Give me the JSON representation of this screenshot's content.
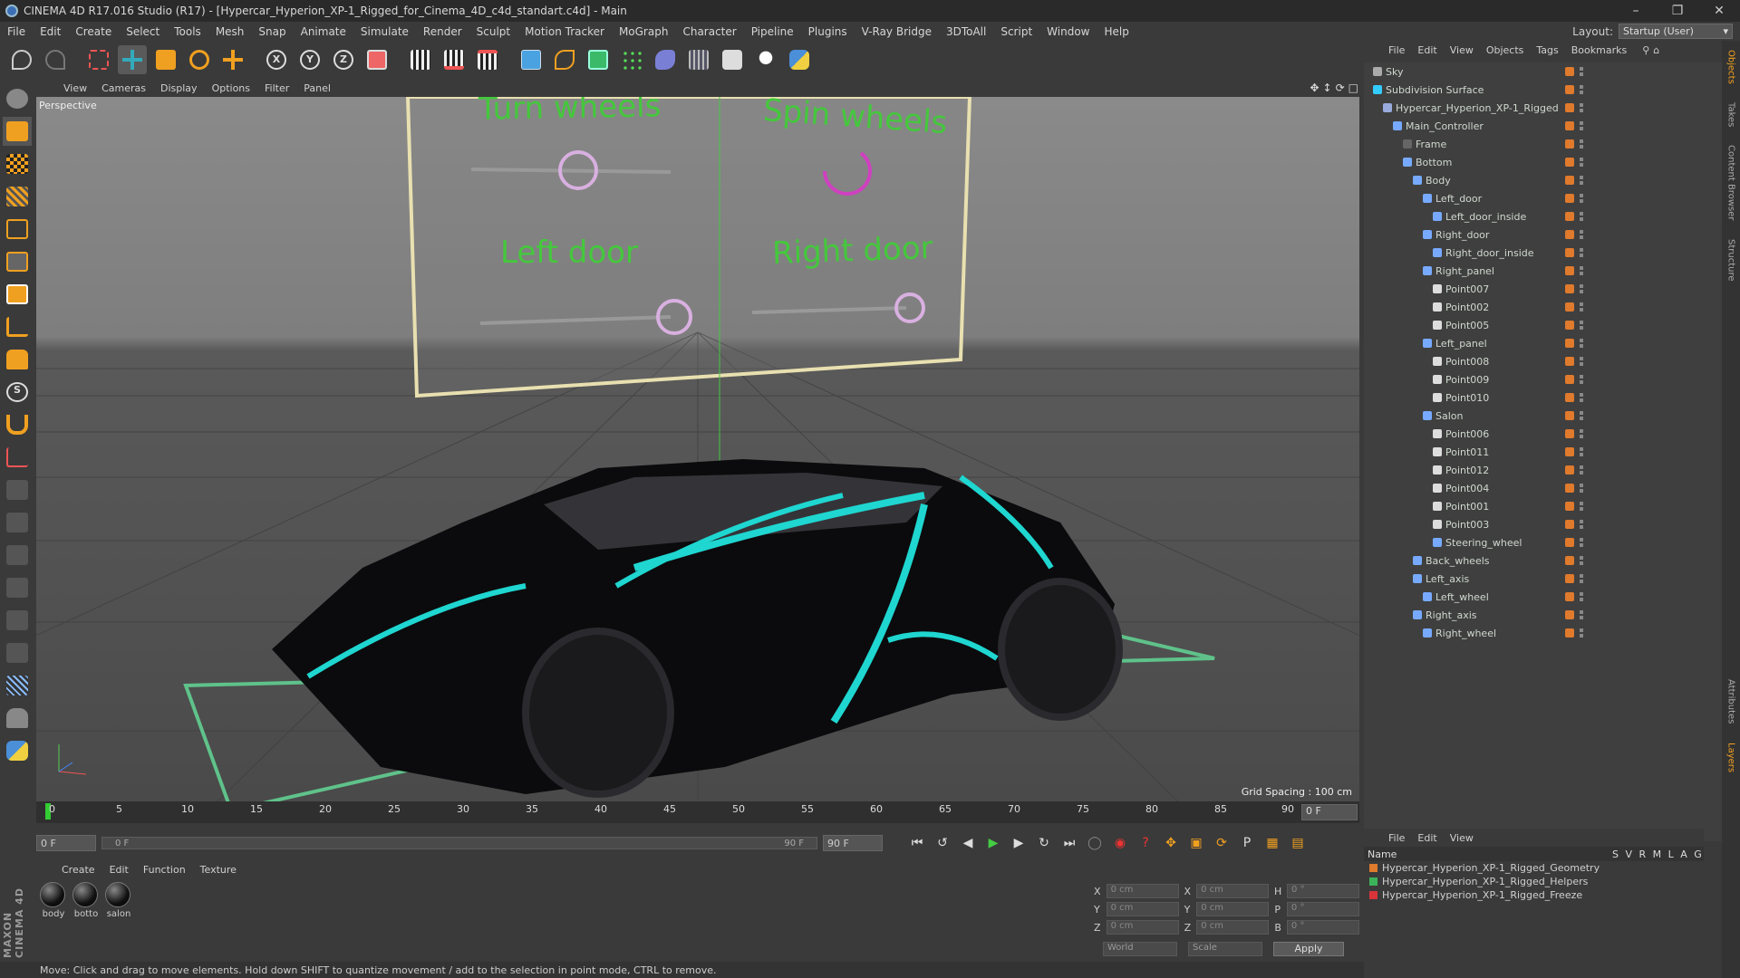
{
  "window": {
    "title": "CINEMA 4D R17.016 Studio (R17) - [Hypercar_Hyperion_XP-1_Rigged_for_Cinema_4D_c4d_standart.c4d] - Main"
  },
  "menubar": [
    "File",
    "Edit",
    "Create",
    "Select",
    "Tools",
    "Mesh",
    "Snap",
    "Animate",
    "Simulate",
    "Render",
    "Sculpt",
    "Motion Tracker",
    "MoGraph",
    "Character",
    "Pipeline",
    "Plugins",
    "V-Ray Bridge",
    "3DToAll",
    "Script",
    "Window",
    "Help"
  ],
  "layout": {
    "label": "Layout:",
    "value": "Startup (User)"
  },
  "viewport": {
    "menu": [
      "View",
      "Cameras",
      "Display",
      "Options",
      "Filter",
      "Panel"
    ],
    "label": "Perspective",
    "grid_spacing": "Grid Spacing : 100 cm",
    "controls": {
      "turn_wheels": "Turn wheels",
      "spin_wheels": "Spin wheels",
      "left_door": "Left door",
      "right_door": "Right door"
    }
  },
  "timeline": {
    "ticks": [
      "0",
      "5",
      "10",
      "15",
      "20",
      "25",
      "30",
      "35",
      "40",
      "45",
      "50",
      "55",
      "60",
      "65",
      "70",
      "75",
      "80",
      "85",
      "90"
    ],
    "current": "0 F"
  },
  "range": {
    "start": "0 F",
    "slider_start": "0 F",
    "slider_end": "90 F",
    "end": "90 F"
  },
  "materials": {
    "menu": [
      "Create",
      "Edit",
      "Function",
      "Texture"
    ],
    "items": [
      "body",
      "botto",
      "salon"
    ]
  },
  "coords": {
    "rows": [
      {
        "a1": "X",
        "v1": "0 cm",
        "a2": "X",
        "v2": "0 cm",
        "a3": "H",
        "v3": "0 °"
      },
      {
        "a1": "Y",
        "v1": "0 cm",
        "a2": "Y",
        "v2": "0 cm",
        "a3": "P",
        "v3": "0 °"
      },
      {
        "a1": "Z",
        "v1": "0 cm",
        "a2": "Z",
        "v2": "0 cm",
        "a3": "B",
        "v3": "0 °"
      }
    ],
    "world": "World",
    "scale": "Scale",
    "apply": "Apply"
  },
  "status": "Move: Click and drag to move elements. Hold down SHIFT to quantize movement / add to the selection in point mode, CTRL to remove.",
  "brand": "MAXON CINEMA 4D",
  "objects": {
    "menu": [
      "File",
      "Edit",
      "View",
      "Objects",
      "Tags",
      "Bookmarks"
    ],
    "tree": [
      {
        "name": "Sky",
        "indent": 0,
        "color": "#aaa"
      },
      {
        "name": "Subdivision Surface",
        "indent": 0,
        "color": "#3cf"
      },
      {
        "name": "Hypercar_Hyperion_XP-1_Rigged",
        "indent": 1,
        "color": "#9ad"
      },
      {
        "name": "Main_Controller",
        "indent": 2,
        "color": "#7af"
      },
      {
        "name": "Frame",
        "indent": 3,
        "color": "#666"
      },
      {
        "name": "Bottom",
        "indent": 3,
        "color": "#7af"
      },
      {
        "name": "Body",
        "indent": 4,
        "color": "#7af"
      },
      {
        "name": "Left_door",
        "indent": 5,
        "color": "#7af"
      },
      {
        "name": "Left_door_inside",
        "indent": 6,
        "color": "#7af"
      },
      {
        "name": "Right_door",
        "indent": 5,
        "color": "#7af"
      },
      {
        "name": "Right_door_inside",
        "indent": 6,
        "color": "#7af"
      },
      {
        "name": "Right_panel",
        "indent": 5,
        "color": "#7af"
      },
      {
        "name": "Point007",
        "indent": 6,
        "color": "#ddd"
      },
      {
        "name": "Point002",
        "indent": 6,
        "color": "#ddd"
      },
      {
        "name": "Point005",
        "indent": 6,
        "color": "#ddd"
      },
      {
        "name": "Left_panel",
        "indent": 5,
        "color": "#7af"
      },
      {
        "name": "Point008",
        "indent": 6,
        "color": "#ddd"
      },
      {
        "name": "Point009",
        "indent": 6,
        "color": "#ddd"
      },
      {
        "name": "Point010",
        "indent": 6,
        "color": "#ddd"
      },
      {
        "name": "Salon",
        "indent": 5,
        "color": "#7af"
      },
      {
        "name": "Point006",
        "indent": 6,
        "color": "#ddd"
      },
      {
        "name": "Point011",
        "indent": 6,
        "color": "#ddd"
      },
      {
        "name": "Point012",
        "indent": 6,
        "color": "#ddd"
      },
      {
        "name": "Point004",
        "indent": 6,
        "color": "#ddd"
      },
      {
        "name": "Point001",
        "indent": 6,
        "color": "#ddd"
      },
      {
        "name": "Point003",
        "indent": 6,
        "color": "#ddd"
      },
      {
        "name": "Steering_wheel",
        "indent": 6,
        "color": "#7af"
      },
      {
        "name": "Back_wheels",
        "indent": 4,
        "color": "#7af"
      },
      {
        "name": "Left_axis",
        "indent": 4,
        "color": "#7af"
      },
      {
        "name": "Left_wheel",
        "indent": 5,
        "color": "#7af"
      },
      {
        "name": "Right_axis",
        "indent": 4,
        "color": "#7af"
      },
      {
        "name": "Right_wheel",
        "indent": 5,
        "color": "#7af"
      }
    ]
  },
  "layers": {
    "menu": [
      "File",
      "Edit",
      "View"
    ],
    "headers": {
      "name": "Name",
      "cols": "S V R M L A G"
    },
    "items": [
      {
        "name": "Hypercar_Hyperion_XP-1_Rigged_Geometry",
        "color": "#e07a2c"
      },
      {
        "name": "Hypercar_Hyperion_XP-1_Rigged_Helpers",
        "color": "#3bb35a"
      },
      {
        "name": "Hypercar_Hyperion_XP-1_Rigged_Freeze",
        "color": "#d8343a"
      }
    ]
  },
  "vtabs": [
    "Objects",
    "Takes",
    "Content Browser",
    "Structure",
    "Attributes",
    "Layers"
  ]
}
